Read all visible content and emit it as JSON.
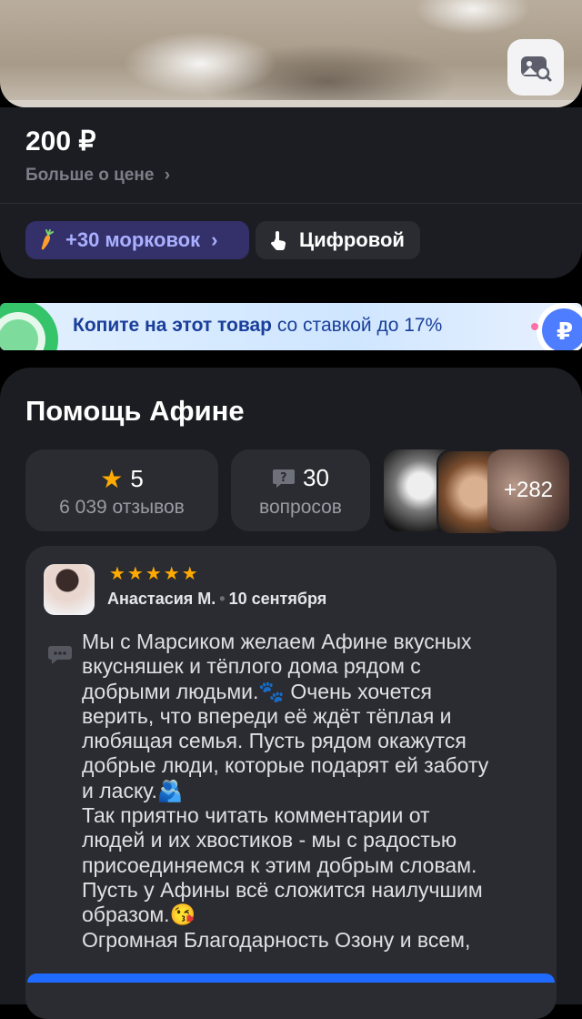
{
  "product": {
    "price": "200 ₽",
    "price_more": "Больше о цене",
    "carrots_chip": "+30 морковок",
    "digital_chip": "Цифровой"
  },
  "banner": {
    "bold": "Копите на этот товар",
    "rest": "со ставкой до 17%"
  },
  "reviews_section": {
    "title": "Помощь Афине",
    "rating": "5",
    "reviews_count": "6 039 отзывов",
    "questions": "30",
    "questions_label": "вопросов",
    "photos_more": "+282"
  },
  "review": {
    "author": "Анастасия М.",
    "date": "10 сентября",
    "stars": "★★★★★",
    "text": "Мы с Марсиком желаем Афине вкусных\nвкусняшек и тёплого дома рядом с\nдобрыми людьми.🐾 Очень хочется\nверить, что впереди её ждёт тёплая и\nлюбящая семья. Пусть рядом окажутся\nдобрые люди, которые подарят ей заботу\nи ласку.🫂\nТак приятно читать комментарии от\nлюдей и их хвостиков - мы с радостью\nприсоединяемся к этим добрым словам.\nПусть у Афины всё сложится наилучшим\nобразом.😘\nОгромная Благодарность Озону и всем,"
  },
  "colors": {
    "accent": "#1f6bff",
    "star": "#ffaa00",
    "carrot_chip": "#33306a"
  },
  "icons": [
    "visual-search-icon",
    "carrot-icon",
    "chevron-right-icon",
    "touch-icon",
    "star-icon",
    "question-icon",
    "comment-icon",
    "ruble-coin-icon"
  ]
}
